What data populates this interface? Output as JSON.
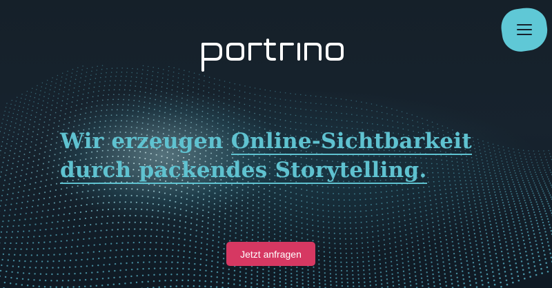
{
  "brand": {
    "logo_text": "portrino"
  },
  "header": {
    "menu_icon": "hamburger-icon"
  },
  "hero": {
    "headline_part1": "Wir erzeugen ",
    "headline_highlight1": "Online-Sichtbarkeit",
    "headline_highlight2": "durch packendes Storytelling",
    "headline_end": ".",
    "cta_label": "Jetzt anfragen"
  },
  "colors": {
    "background": "#141f2a",
    "accent": "#5fc2d0",
    "cta": "#d63862",
    "menu_button": "#5fc8d6"
  }
}
